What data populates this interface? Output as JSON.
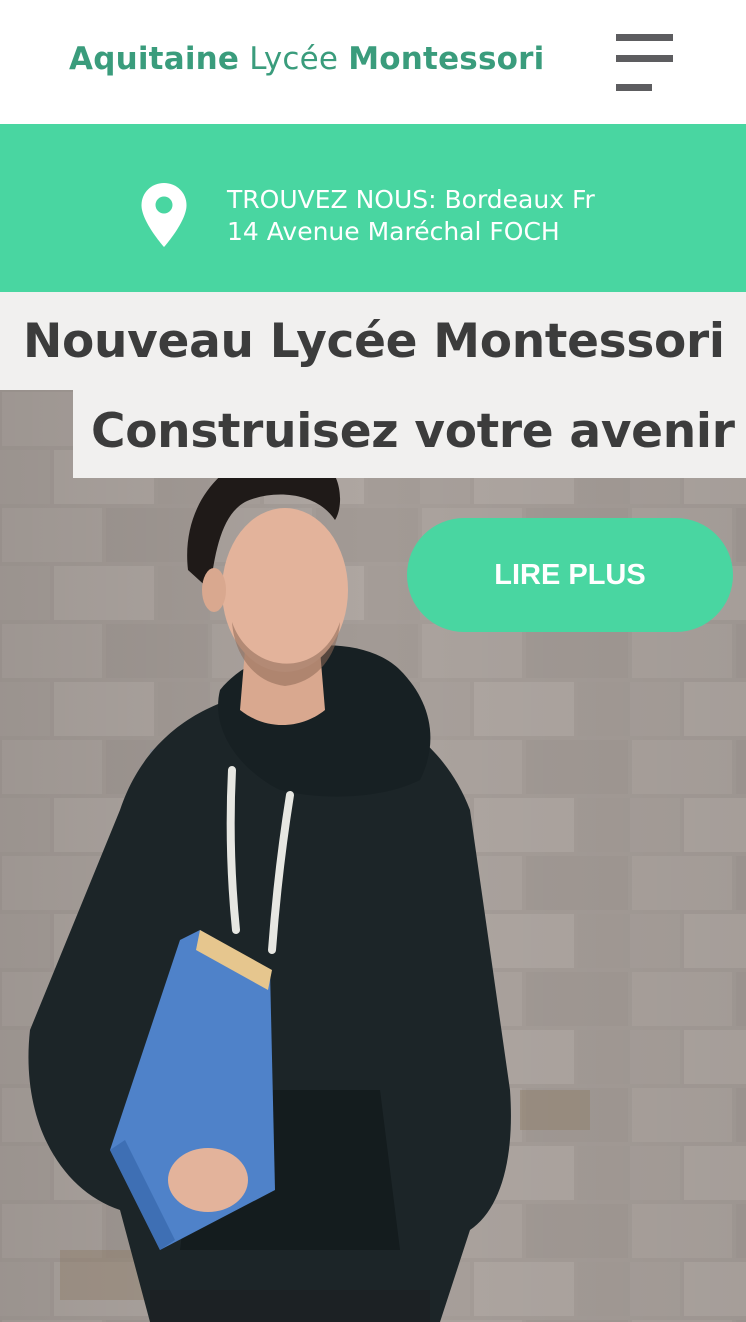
{
  "header": {
    "brand_part1": "Aquitaine",
    "brand_part2": "Lycée",
    "brand_part3": "Montessori",
    "menu_icon": "hamburger-menu-icon"
  },
  "location": {
    "icon": "map-pin-icon",
    "line1": "TROUVEZ NOUS: Bordeaux Fr",
    "line2": "14 Avenue Maréchal FOCH"
  },
  "hero": {
    "title": "Nouveau Lycée Montessori",
    "subtitle": "Construisez votre avenir",
    "cta_label": "LIRE PLUS"
  },
  "colors": {
    "brand_green": "#3a9c7c",
    "accent_green": "#49d6a1",
    "text_dark": "#3c3c3c",
    "band_gray": "#f1f0ef",
    "menu_gray": "#5d5d60"
  }
}
